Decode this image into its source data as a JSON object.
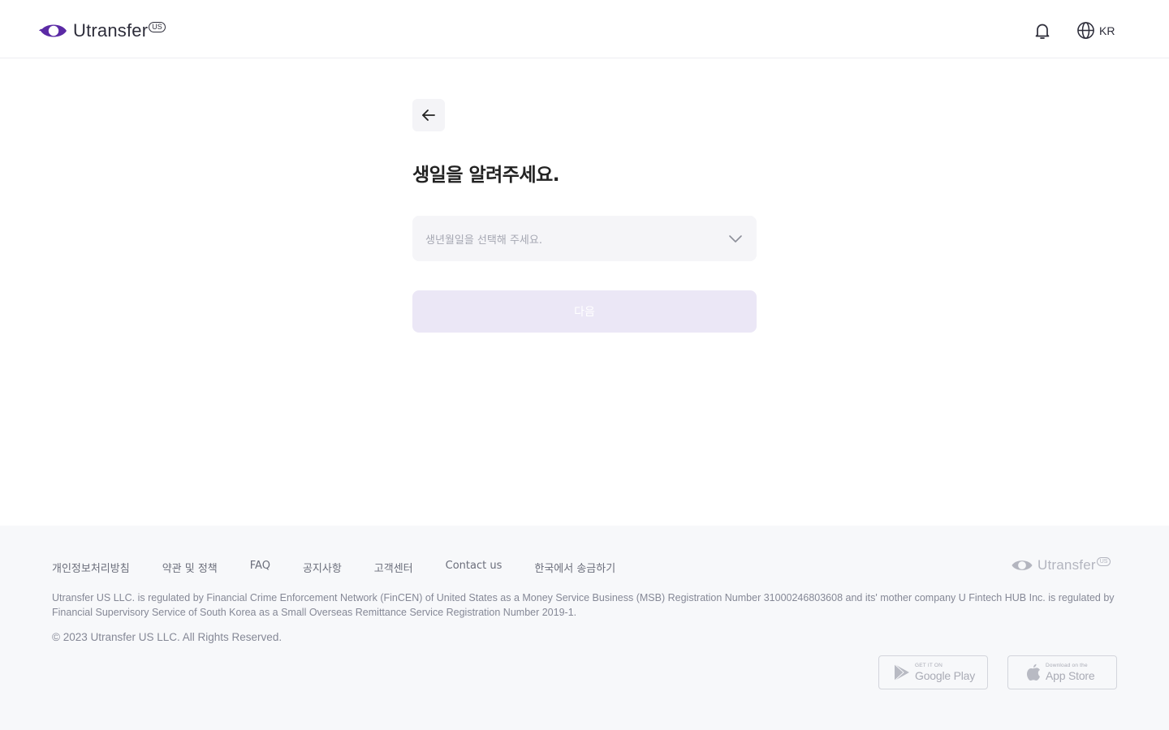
{
  "header": {
    "logo_text": "Utransfer",
    "logo_badge": "US",
    "language": "KR"
  },
  "main": {
    "title": "생일을 알려주세요.",
    "birthdate_placeholder": "생년월일을 선택해 주세요.",
    "next_label": "다음"
  },
  "footer": {
    "links": [
      "개인정보처리방침",
      "약관 및 정책",
      "FAQ",
      "공지사항",
      "고객센터",
      "Contact us",
      "한국에서 송금하기"
    ],
    "logo_text": "Utransfer",
    "logo_badge": "US",
    "disclaimer": "Utransfer US LLC. is regulated by Financial Crime Enforcement Network (FinCEN) of United States as a Money Service Business (MSB) Registration Number 31000246803608 and its' mother company U Fintech HUB Inc. is regulated by Financial Supervisory Service of South Korea as a Small Overseas Remittance Service Registration Number 2019-1.",
    "copyright": "© 2023 Utransfer US LLC. All Rights Reserved.",
    "google_play": {
      "small": "GET IT ON",
      "big": "Google Play"
    },
    "app_store": {
      "small": "Download on the",
      "big": "App Store"
    }
  },
  "colors": {
    "brand": "#5b2aa5",
    "button_disabled": "#ebe7f6",
    "footer_bg": "#f7f8fa"
  },
  "icons": [
    "logo-icon",
    "bell-icon",
    "globe-icon",
    "arrow-left-icon",
    "chevron-down-icon",
    "google-play-icon",
    "apple-icon"
  ]
}
